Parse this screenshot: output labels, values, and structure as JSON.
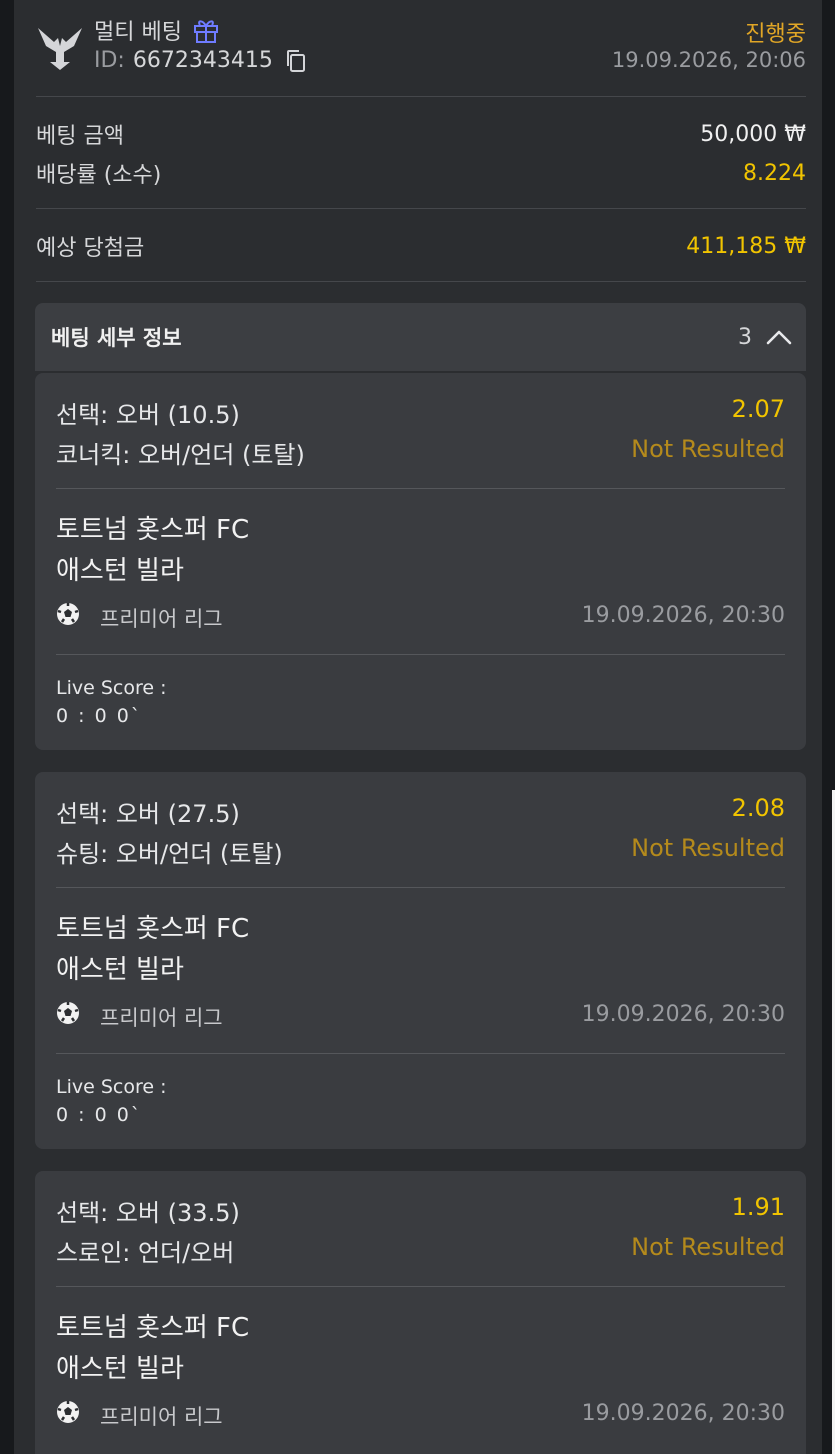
{
  "header": {
    "bet_type": "멀티 베팅",
    "id_label": "ID:",
    "id_value": "6672343415",
    "status": "진행중",
    "datetime": "19.09.2026, 20:06"
  },
  "summary": {
    "stake_label": "베팅 금액",
    "stake_value": "50,000 ₩",
    "odds_label": "배당률 (소수)",
    "odds_value": "8.224",
    "payout_label": "예상 당첨금",
    "payout_value": "411,185 ₩"
  },
  "details": {
    "title": "베팅 세부 정보",
    "count": "3"
  },
  "colors": {
    "accent_yellow": "#f1c400",
    "status_orange": "#e1a626",
    "not_resulted": "#b48a1c"
  },
  "selections": [
    {
      "selection": "선택: 오버 (10.5)",
      "market": "코너킥: 오버/언더 (토탈)",
      "odds": "2.07",
      "result": "Not Resulted",
      "home": "토트넘 홋스퍼 FC",
      "away": "애스턴 빌라",
      "sport_icon": "soccer-ball-icon",
      "league": "프리미어 리그",
      "match_date": "19.09.2026, 20:30",
      "live_label": "Live Score :",
      "live_value": "0 : 0 0`"
    },
    {
      "selection": "선택: 오버 (27.5)",
      "market": "슈팅: 오버/언더 (토탈)",
      "odds": "2.08",
      "result": "Not Resulted",
      "home": "토트넘 홋스퍼 FC",
      "away": "애스턴 빌라",
      "sport_icon": "soccer-ball-icon",
      "league": "프리미어 리그",
      "match_date": "19.09.2026, 20:30",
      "live_label": "Live Score :",
      "live_value": "0 : 0 0`"
    },
    {
      "selection": "선택: 오버 (33.5)",
      "market": "스로인: 언더/오버",
      "odds": "1.91",
      "result": "Not Resulted",
      "home": "토트넘 홋스퍼 FC",
      "away": "애스턴 빌라",
      "sport_icon": "soccer-ball-icon",
      "league": "프리미어 리그",
      "match_date": "19.09.2026, 20:30"
    }
  ]
}
